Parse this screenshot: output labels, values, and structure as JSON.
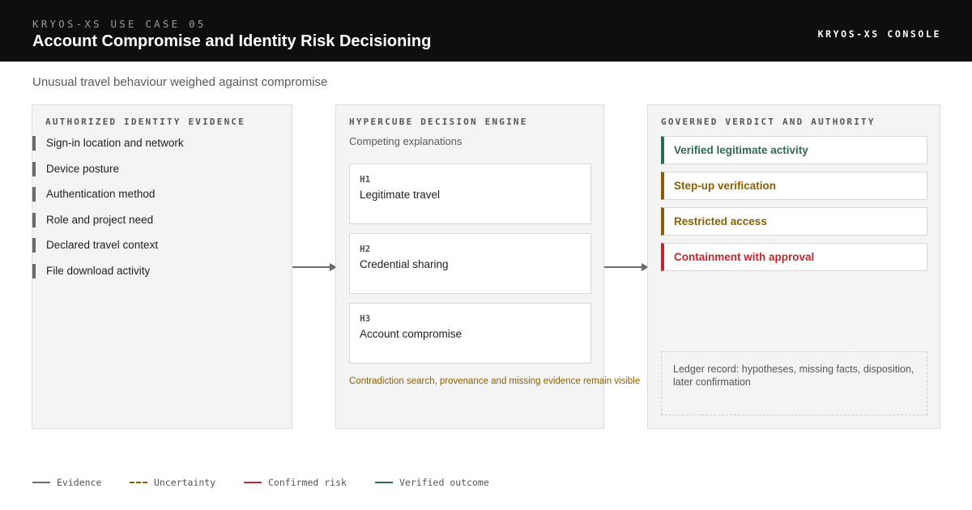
{
  "header": {
    "eyebrow": "KRYOS-XS USE CASE 05",
    "title": "Account Compromise and Identity Risk Decisioning",
    "console_label": "KRYOS-XS CONSOLE"
  },
  "subtitle": "Unusual travel behaviour weighed against compromise",
  "evidence_panel": {
    "heading": "AUTHORIZED IDENTITY EVIDENCE",
    "items": [
      "Sign-in location and network",
      "Device posture",
      "Authentication method",
      "Role and project need",
      "Declared travel context",
      "File download activity"
    ]
  },
  "engine_panel": {
    "heading": "HYPERCUBE DECISION ENGINE",
    "subheading": "Competing explanations",
    "hypotheses": [
      {
        "code": "H1",
        "label": "Legitimate travel"
      },
      {
        "code": "H2",
        "label": "Credential sharing"
      },
      {
        "code": "H3",
        "label": "Account compromise"
      }
    ],
    "note": "Contradiction search, provenance and missing evidence remain visible"
  },
  "verdict_panel": {
    "heading": "GOVERNED VERDICT AND AUTHORITY",
    "verdicts": [
      {
        "label": "Verified legitimate activity",
        "color": "#2e6b52"
      },
      {
        "label": "Step-up verification",
        "color": "#8a5f00"
      },
      {
        "label": "Restricted access",
        "color": "#8a5f00"
      },
      {
        "label": "Containment with approval",
        "color": "#c0272d"
      }
    ],
    "ledger": "Ledger record: hypotheses, missing facts, disposition, later confirmation"
  },
  "legend": [
    {
      "label": "Evidence",
      "color": "#6b6b6b",
      "style": "solid"
    },
    {
      "label": "Uncertainty",
      "color": "#8a5f00",
      "style": "dashed"
    },
    {
      "label": "Confirmed risk",
      "color": "#c0272d",
      "style": "solid"
    },
    {
      "label": "Verified outcome",
      "color": "#2e6b52",
      "style": "solid"
    }
  ]
}
